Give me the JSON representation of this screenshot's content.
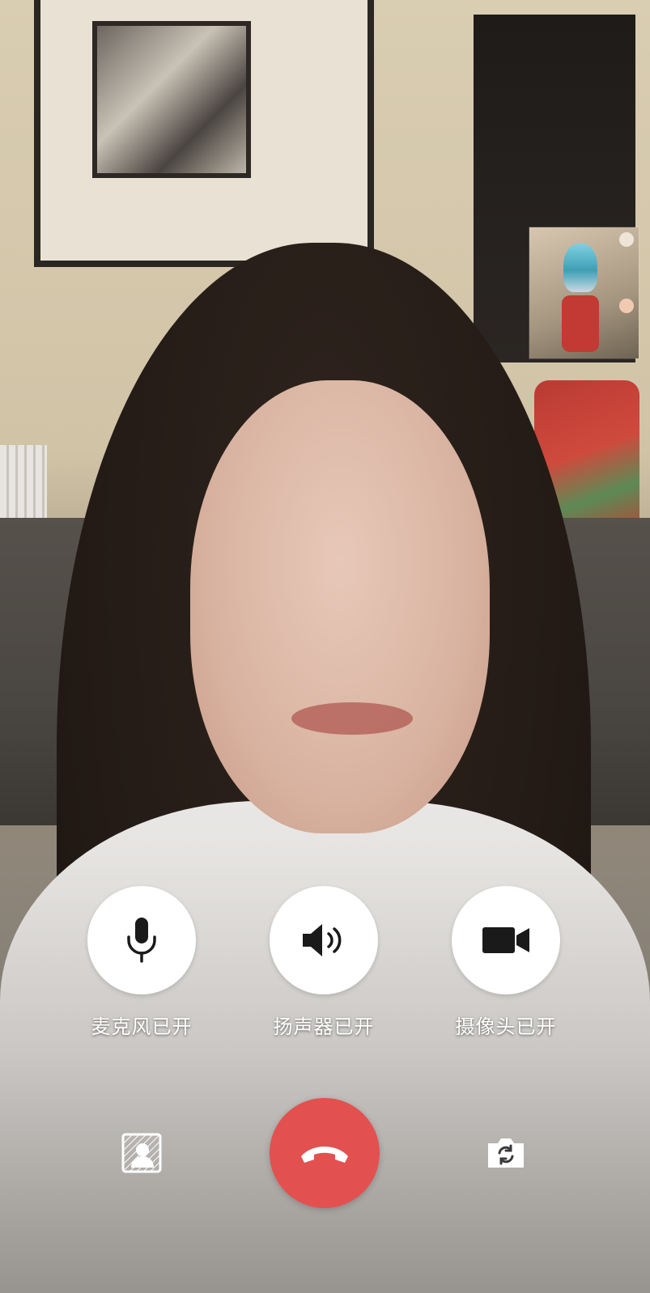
{
  "call": {
    "controls": {
      "microphone": {
        "label": "麦克风已开",
        "icon": "microphone-icon"
      },
      "speaker": {
        "label": "扬声器已开",
        "icon": "speaker-icon"
      },
      "camera": {
        "label": "摄像头已开",
        "icon": "video-camera-icon"
      }
    },
    "bottom_bar": {
      "background_blur_icon": "background-blur-icon",
      "hangup_icon": "phone-hangup-icon",
      "switch_camera_icon": "switch-camera-icon"
    },
    "colors": {
      "hangup": "#e2514f",
      "control_button": "#ffffff",
      "label_text": "#ffffff",
      "icon": "#1a1a1a"
    }
  }
}
